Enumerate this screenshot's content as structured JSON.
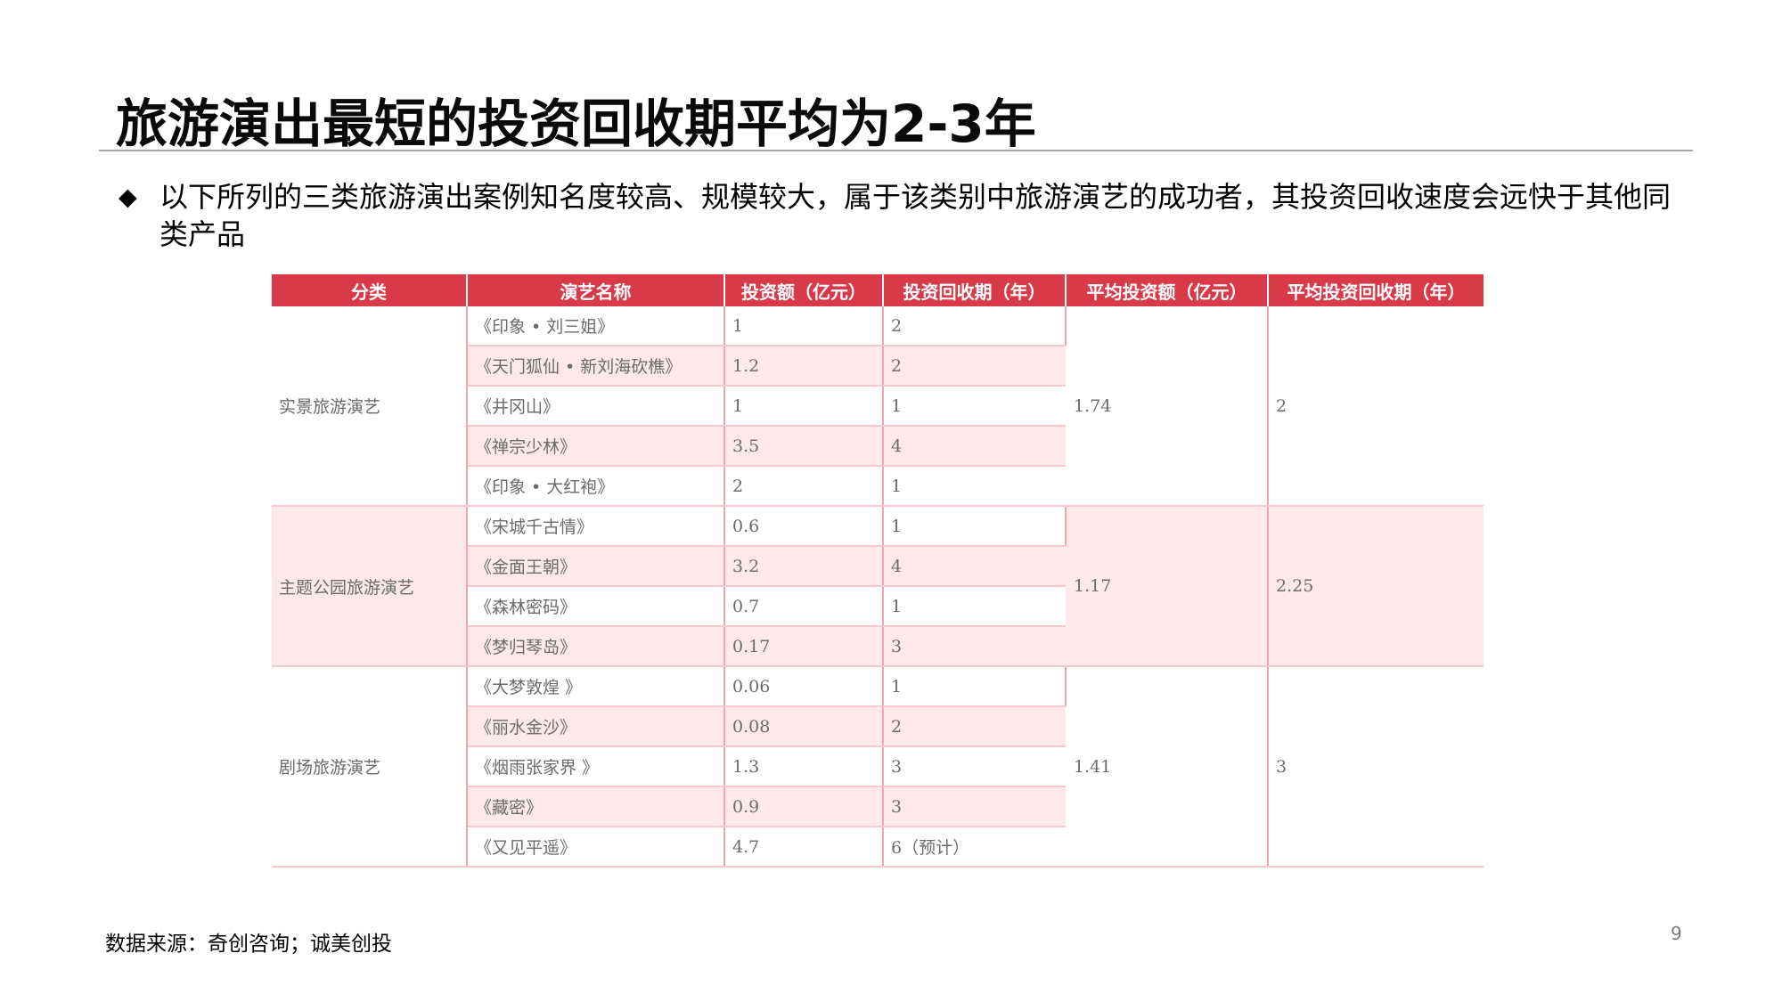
{
  "title": "旅游演出最短的投资回收期平均为2-3年",
  "bullet": {
    "marker": "◆",
    "text": "以下所列的三类旅游演出案例知名度较高、规模较大，属于该类别中旅游演艺的成功者，其投资回收速度会远快于其他同类产品"
  },
  "table": {
    "headers": [
      "分类",
      "演艺名称",
      "投资额（亿元）",
      "投资回收期（年）",
      "平均投资额（亿元）",
      "平均投资回收期（年）"
    ],
    "groups": [
      {
        "category": "实景旅游演艺",
        "avg_investment": "1.74",
        "avg_payback": "2",
        "rows": [
          {
            "name": "《印象 • 刘三姐》",
            "investment": "1",
            "payback": "2"
          },
          {
            "name": "《天门狐仙 • 新刘海砍樵》",
            "investment": "1.2",
            "payback": "2"
          },
          {
            "name": "《井冈山》",
            "investment": "1",
            "payback": "1"
          },
          {
            "name": "《禅宗少林》",
            "investment": "3.5",
            "payback": "4"
          },
          {
            "name": "《印象 • 大红袍》",
            "investment": "2",
            "payback": "1"
          }
        ]
      },
      {
        "category": "主题公园旅游演艺",
        "avg_investment": "1.17",
        "avg_payback": "2.25",
        "rows": [
          {
            "name": "《宋城千古情》",
            "investment": "0.6",
            "payback": "1"
          },
          {
            "name": "《金面王朝》",
            "investment": "3.2",
            "payback": "4"
          },
          {
            "name": "《森林密码》",
            "investment": "0.7",
            "payback": "1"
          },
          {
            "name": "《梦归琴岛》",
            "investment": "0.17",
            "payback": "3"
          }
        ]
      },
      {
        "category": "剧场旅游演艺",
        "avg_investment": "1.41",
        "avg_payback": "3",
        "rows": [
          {
            "name": "《大梦敦煌 》",
            "investment": "0.06",
            "payback": "1"
          },
          {
            "name": "《丽水金沙》",
            "investment": "0.08",
            "payback": "2"
          },
          {
            "name": "《烟雨张家界 》",
            "investment": "1.3",
            "payback": "3"
          },
          {
            "name": "《藏密》",
            "investment": "0.9",
            "payback": "3"
          },
          {
            "name": "《又见平遥》",
            "investment": "4.7",
            "payback": "6（预计）"
          }
        ]
      }
    ]
  },
  "source": "数据来源：奇创咨询；诚美创投",
  "page_number": "9",
  "colors": {
    "header_bg": "#d93a4a",
    "alt_row_bg": "#fde9ec",
    "grid_line": "#f0a6ae"
  }
}
